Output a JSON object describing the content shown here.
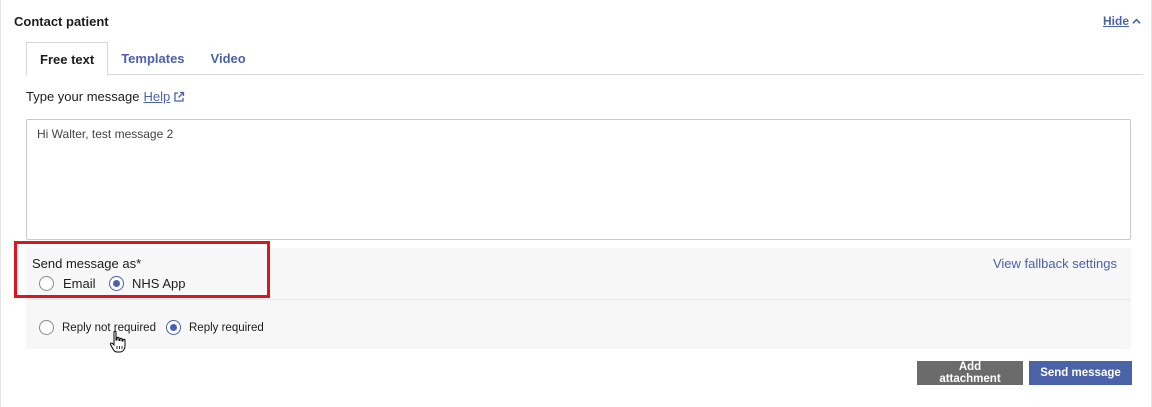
{
  "section": {
    "title": "Contact patient",
    "hide_label": "Hide"
  },
  "tabs": [
    {
      "label": "Free text",
      "active": true
    },
    {
      "label": "Templates",
      "active": false
    },
    {
      "label": "Video",
      "active": false
    }
  ],
  "message": {
    "label": "Type your message",
    "help_label": "Help",
    "value": "Hi Walter, test message 2"
  },
  "send_as": {
    "label": "Send message as*",
    "options": [
      {
        "label": "Email",
        "checked": false
      },
      {
        "label": "NHS App",
        "checked": true
      }
    ],
    "fallback_link": "View fallback settings"
  },
  "reply": {
    "options": [
      {
        "label": "Reply not required",
        "checked": false
      },
      {
        "label": "Reply required",
        "checked": true
      }
    ]
  },
  "actions": {
    "attach_label": "Add attachment",
    "send_label": "Send message"
  },
  "colors": {
    "accent": "#4a62a8",
    "highlight": "#e0141e",
    "secondary_button": "#6b6b6b"
  }
}
